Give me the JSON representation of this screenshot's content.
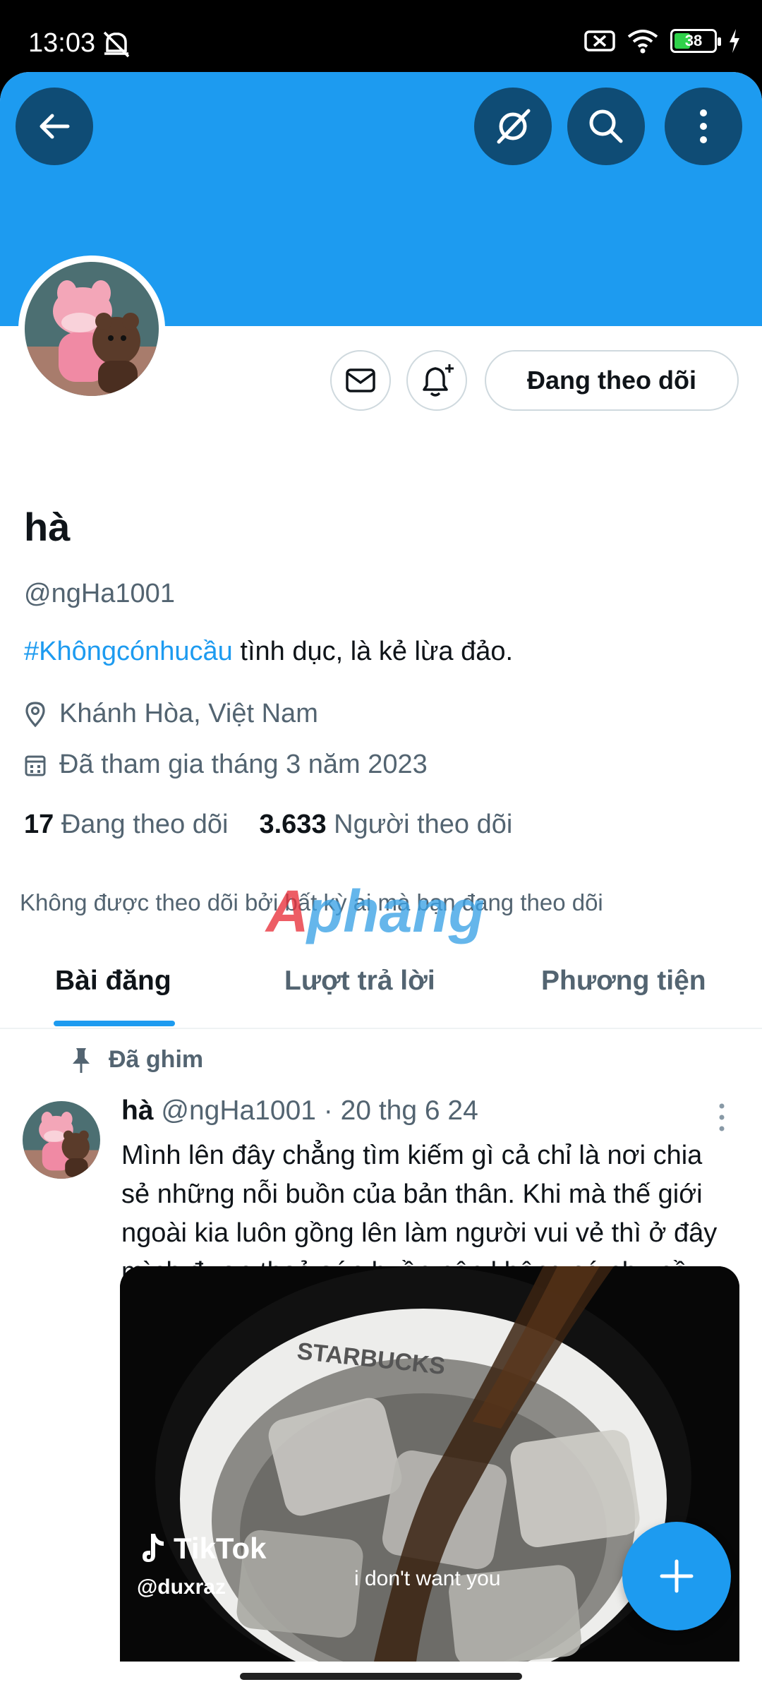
{
  "status_bar": {
    "time": "13:03",
    "battery": "38"
  },
  "toolbar": {
    "back_icon": "arrow-left-icon",
    "grok_icon": "slash-circle-icon",
    "search_icon": "search-icon",
    "more_icon": "more-vertical-icon"
  },
  "profile": {
    "name": "hà",
    "handle": "@ngHa1001",
    "bio_hashtag": "#Khôngcónhucầu",
    "bio_text": " tình dục, là kẻ lừa đảo.",
    "location": "Khánh Hòa, Việt Nam",
    "joined": "Đã tham gia tháng 3 năm 2023",
    "following_count": "17",
    "following_label": "Đang theo dõi",
    "followers_count": "3.633",
    "followers_label": "Người theo dõi",
    "not_followed_by": "Không được theo dõi bởi bất kỳ ai mà bạn đang theo dõi",
    "follow_button": "Đang theo dõi"
  },
  "watermark": "Aphang",
  "tabs": [
    {
      "label": "Bài đăng",
      "active": true
    },
    {
      "label": "Lượt trả lời",
      "active": false
    },
    {
      "label": "Phương tiện",
      "active": false
    }
  ],
  "pinned_tweet": {
    "pinned_label": "Đã ghim",
    "author": "hà",
    "handle": "@ngHa1001",
    "date": "· 20 thg 6 24",
    "text": "Mình lên đây chẳng tìm kiếm gì cả chỉ là nơi chia sẻ những nỗi buồn của bản thân. Khi mà thế giới ngoài kia luôn gồng lên làm người vui vẻ thì ở đây mình được thoả sức buồn nên không có nhu cầu gì khác. Xin cảm ơn",
    "media": {
      "cup_text": "STARBUCKS",
      "brand": "TikTok",
      "username": "@duxraz",
      "caption": "i don't want you"
    }
  },
  "colors": {
    "accent": "#1d9bf0",
    "banner": "#1d9bf0",
    "text_primary": "#0f1419",
    "text_secondary": "#536471"
  }
}
